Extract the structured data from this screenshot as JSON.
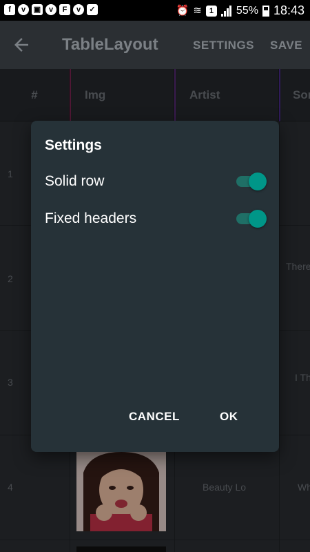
{
  "status_bar": {
    "battery_percent": "55%",
    "time": "18:43"
  },
  "toolbar": {
    "title": "TableLayout",
    "settings_label": "SETTINGS",
    "save_label": "SAVE"
  },
  "table": {
    "headers": [
      "#",
      "Img",
      "Artist",
      "Sor"
    ],
    "rows": [
      {
        "num": "1",
        "artist": "",
        "song": ""
      },
      {
        "num": "2",
        "artist": "",
        "song": "There Mo"
      },
      {
        "num": "3",
        "artist": "",
        "song": "I Th N"
      },
      {
        "num": "4",
        "artist": "Beauty Lo",
        "song": "Wh"
      }
    ]
  },
  "dialog": {
    "title": "Settings",
    "options": [
      {
        "label": "Solid row",
        "checked": true
      },
      {
        "label": "Fixed headers",
        "checked": true
      }
    ],
    "cancel_label": "CANCEL",
    "ok_label": "OK"
  },
  "colors": {
    "accent": "#009688",
    "dialog_bg": "#263238",
    "app_bg": "#2b2f33"
  }
}
